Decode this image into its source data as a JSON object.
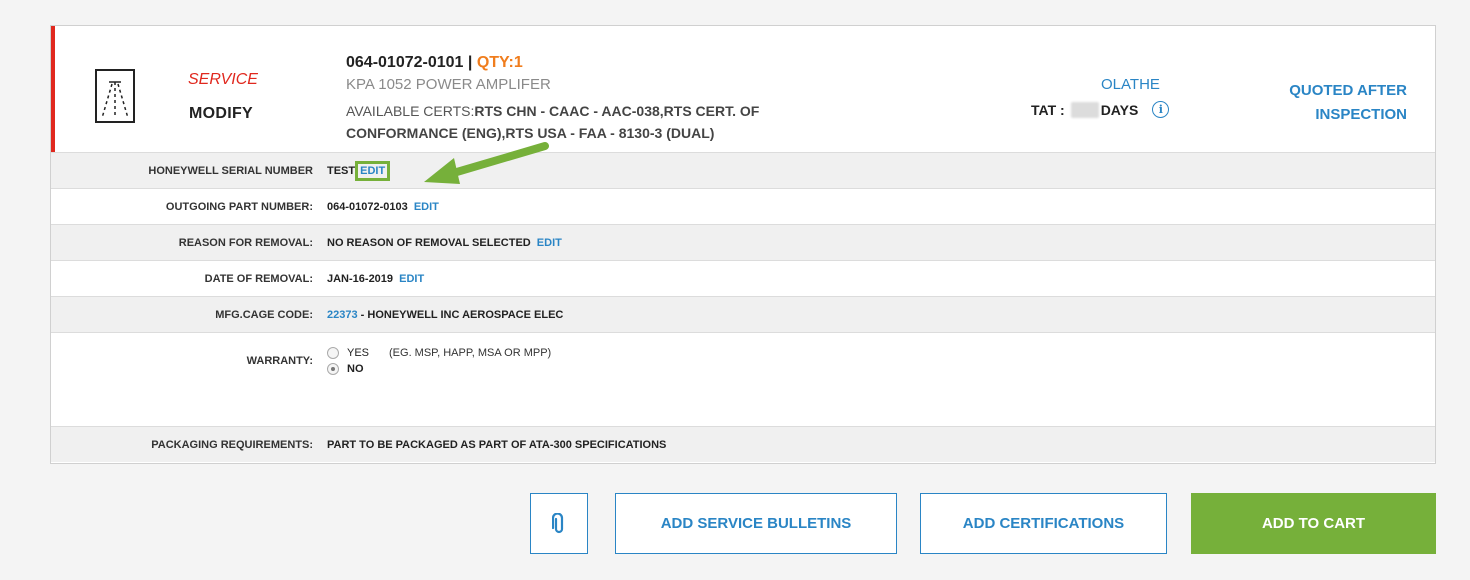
{
  "item": {
    "service_label": "SERVICE",
    "modify_label": "MODIFY",
    "part_number": "064-01072-0101 |",
    "qty": "QTY:1",
    "description": "KPA 1052 POWER AMPLIFER",
    "certs_prefix": "AVAILABLE CERTS:",
    "certs_value": "RTS CHN - CAAC - AAC-038,RTS CERT. OF CONFORMANCE (ENG),RTS USA - FAA - 8130-3 (DUAL)",
    "location": "OLATHE",
    "tat_label": "TAT :",
    "tat_unit": "DAYS",
    "info_icon": "info-icon",
    "price_text": "QUOTED AFTER INSPECTION"
  },
  "details": {
    "serial_label": "HONEYWELL SERIAL NUMBER",
    "serial_value": "TEST",
    "outgoing_label": "OUTGOING PART NUMBER:",
    "outgoing_value": "064-01072-0103",
    "reason_label": "REASON FOR REMOVAL:",
    "reason_value": "NO REASON OF REMOVAL SELECTED",
    "date_label": "DATE OF REMOVAL:",
    "date_value": "JAN-16-2019",
    "cage_label": "MFG.CAGE CODE:",
    "cage_code": "22373",
    "cage_value": " - HONEYWELL INC AEROSPACE ELEC",
    "warranty_label": "WARRANTY:",
    "warranty_yes": "YES",
    "warranty_yes_note": "(EG. MSP, HAPP, MSA OR MPP)",
    "warranty_no": "NO",
    "warranty_selected": "NO",
    "packaging_label": "PACKAGING REQUIREMENTS:",
    "packaging_value": "PART TO BE PACKAGED AS PART OF ATA-300 SPECIFICATIONS",
    "edit_label": "EDIT"
  },
  "actions": {
    "attach_icon": "paperclip-icon",
    "service_bulletins": "ADD SERVICE BULLETINS",
    "certifications": "ADD CERTIFICATIONS",
    "add_to_cart": "ADD TO CART"
  },
  "colors": {
    "accent_blue": "#2a85c5",
    "service_red": "#e0281e",
    "qty_orange": "#f07d1d",
    "cart_green": "#76b03a"
  }
}
